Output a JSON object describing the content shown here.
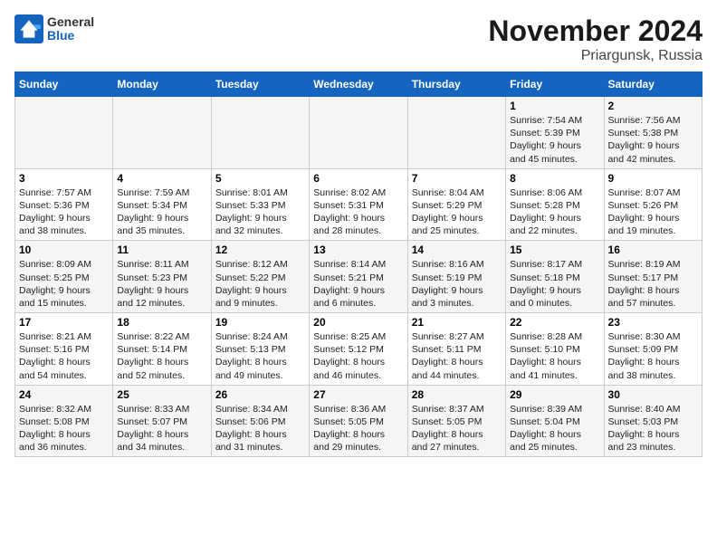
{
  "logo": {
    "line1": "General",
    "line2": "Blue"
  },
  "title": "November 2024",
  "location": "Priargunsk, Russia",
  "weekdays": [
    "Sunday",
    "Monday",
    "Tuesday",
    "Wednesday",
    "Thursday",
    "Friday",
    "Saturday"
  ],
  "weeks": [
    [
      {
        "day": "",
        "info": ""
      },
      {
        "day": "",
        "info": ""
      },
      {
        "day": "",
        "info": ""
      },
      {
        "day": "",
        "info": ""
      },
      {
        "day": "",
        "info": ""
      },
      {
        "day": "1",
        "info": "Sunrise: 7:54 AM\nSunset: 5:39 PM\nDaylight: 9 hours\nand 45 minutes."
      },
      {
        "day": "2",
        "info": "Sunrise: 7:56 AM\nSunset: 5:38 PM\nDaylight: 9 hours\nand 42 minutes."
      }
    ],
    [
      {
        "day": "3",
        "info": "Sunrise: 7:57 AM\nSunset: 5:36 PM\nDaylight: 9 hours\nand 38 minutes."
      },
      {
        "day": "4",
        "info": "Sunrise: 7:59 AM\nSunset: 5:34 PM\nDaylight: 9 hours\nand 35 minutes."
      },
      {
        "day": "5",
        "info": "Sunrise: 8:01 AM\nSunset: 5:33 PM\nDaylight: 9 hours\nand 32 minutes."
      },
      {
        "day": "6",
        "info": "Sunrise: 8:02 AM\nSunset: 5:31 PM\nDaylight: 9 hours\nand 28 minutes."
      },
      {
        "day": "7",
        "info": "Sunrise: 8:04 AM\nSunset: 5:29 PM\nDaylight: 9 hours\nand 25 minutes."
      },
      {
        "day": "8",
        "info": "Sunrise: 8:06 AM\nSunset: 5:28 PM\nDaylight: 9 hours\nand 22 minutes."
      },
      {
        "day": "9",
        "info": "Sunrise: 8:07 AM\nSunset: 5:26 PM\nDaylight: 9 hours\nand 19 minutes."
      }
    ],
    [
      {
        "day": "10",
        "info": "Sunrise: 8:09 AM\nSunset: 5:25 PM\nDaylight: 9 hours\nand 15 minutes."
      },
      {
        "day": "11",
        "info": "Sunrise: 8:11 AM\nSunset: 5:23 PM\nDaylight: 9 hours\nand 12 minutes."
      },
      {
        "day": "12",
        "info": "Sunrise: 8:12 AM\nSunset: 5:22 PM\nDaylight: 9 hours\nand 9 minutes."
      },
      {
        "day": "13",
        "info": "Sunrise: 8:14 AM\nSunset: 5:21 PM\nDaylight: 9 hours\nand 6 minutes."
      },
      {
        "day": "14",
        "info": "Sunrise: 8:16 AM\nSunset: 5:19 PM\nDaylight: 9 hours\nand 3 minutes."
      },
      {
        "day": "15",
        "info": "Sunrise: 8:17 AM\nSunset: 5:18 PM\nDaylight: 9 hours\nand 0 minutes."
      },
      {
        "day": "16",
        "info": "Sunrise: 8:19 AM\nSunset: 5:17 PM\nDaylight: 8 hours\nand 57 minutes."
      }
    ],
    [
      {
        "day": "17",
        "info": "Sunrise: 8:21 AM\nSunset: 5:16 PM\nDaylight: 8 hours\nand 54 minutes."
      },
      {
        "day": "18",
        "info": "Sunrise: 8:22 AM\nSunset: 5:14 PM\nDaylight: 8 hours\nand 52 minutes."
      },
      {
        "day": "19",
        "info": "Sunrise: 8:24 AM\nSunset: 5:13 PM\nDaylight: 8 hours\nand 49 minutes."
      },
      {
        "day": "20",
        "info": "Sunrise: 8:25 AM\nSunset: 5:12 PM\nDaylight: 8 hours\nand 46 minutes."
      },
      {
        "day": "21",
        "info": "Sunrise: 8:27 AM\nSunset: 5:11 PM\nDaylight: 8 hours\nand 44 minutes."
      },
      {
        "day": "22",
        "info": "Sunrise: 8:28 AM\nSunset: 5:10 PM\nDaylight: 8 hours\nand 41 minutes."
      },
      {
        "day": "23",
        "info": "Sunrise: 8:30 AM\nSunset: 5:09 PM\nDaylight: 8 hours\nand 38 minutes."
      }
    ],
    [
      {
        "day": "24",
        "info": "Sunrise: 8:32 AM\nSunset: 5:08 PM\nDaylight: 8 hours\nand 36 minutes."
      },
      {
        "day": "25",
        "info": "Sunrise: 8:33 AM\nSunset: 5:07 PM\nDaylight: 8 hours\nand 34 minutes."
      },
      {
        "day": "26",
        "info": "Sunrise: 8:34 AM\nSunset: 5:06 PM\nDaylight: 8 hours\nand 31 minutes."
      },
      {
        "day": "27",
        "info": "Sunrise: 8:36 AM\nSunset: 5:05 PM\nDaylight: 8 hours\nand 29 minutes."
      },
      {
        "day": "28",
        "info": "Sunrise: 8:37 AM\nSunset: 5:05 PM\nDaylight: 8 hours\nand 27 minutes."
      },
      {
        "day": "29",
        "info": "Sunrise: 8:39 AM\nSunset: 5:04 PM\nDaylight: 8 hours\nand 25 minutes."
      },
      {
        "day": "30",
        "info": "Sunrise: 8:40 AM\nSunset: 5:03 PM\nDaylight: 8 hours\nand 23 minutes."
      }
    ]
  ]
}
